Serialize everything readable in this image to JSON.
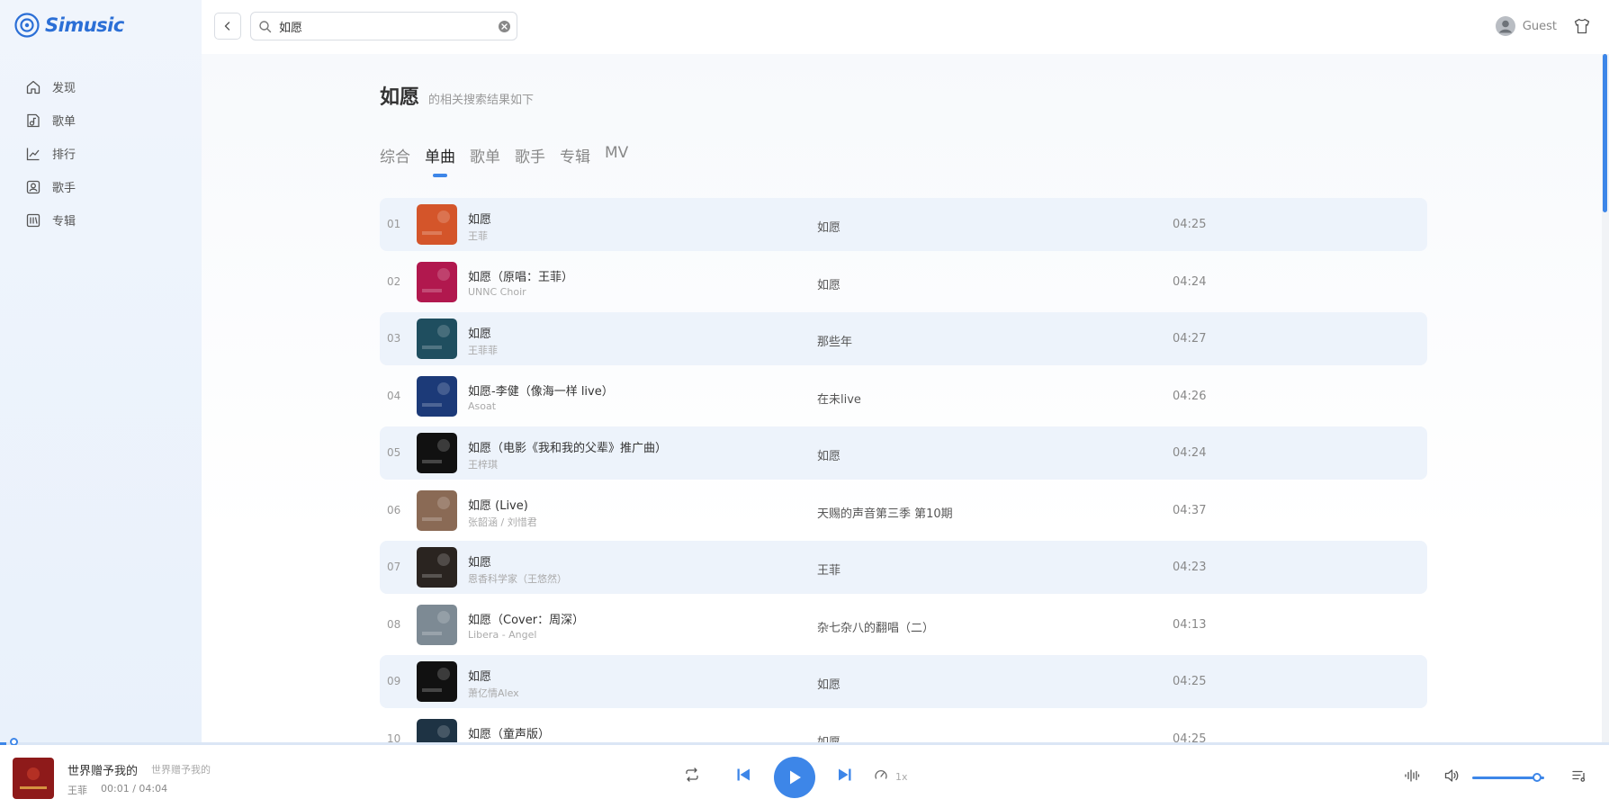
{
  "app": {
    "name": "Simusic"
  },
  "colors": {
    "accent": "#3d86e8",
    "stripe": "#edf3fb",
    "sidebar": "#eef4fb"
  },
  "sidebar": {
    "items": [
      {
        "label": "发现",
        "icon": "home-icon"
      },
      {
        "label": "歌单",
        "icon": "playlist-icon"
      },
      {
        "label": "排行",
        "icon": "chart-icon"
      },
      {
        "label": "歌手",
        "icon": "singer-icon"
      },
      {
        "label": "专辑",
        "icon": "album-icon"
      }
    ]
  },
  "header": {
    "search_value": "如愿",
    "user_name": "Guest"
  },
  "search": {
    "query": "如愿",
    "subtitle": "的相关搜索结果如下",
    "tabs": [
      "综合",
      "单曲",
      "歌单",
      "歌手",
      "专辑",
      "MV"
    ],
    "active_tab": "单曲"
  },
  "songs": [
    {
      "no": "01",
      "title": "如愿",
      "artist": "王菲",
      "album": "如愿",
      "duration": "04:25",
      "cover_color": "#d4552a"
    },
    {
      "no": "02",
      "title": "如愿（原唱：王菲）",
      "artist": "UNNC Choir",
      "album": "如愿",
      "duration": "04:24",
      "cover_color": "#b1184e"
    },
    {
      "no": "03",
      "title": "如愿",
      "artist": "王菲菲",
      "album": "那些年",
      "duration": "04:27",
      "cover_color": "#1f4e5f"
    },
    {
      "no": "04",
      "title": "如愿-李健（像海一样 live）",
      "artist": "Asoat",
      "album": "在未live",
      "duration": "04:26",
      "cover_color": "#1c3a78"
    },
    {
      "no": "05",
      "title": "如愿（电影《我和我的父辈》推广曲）",
      "artist": "王梓琪",
      "album": "如愿",
      "duration": "04:24",
      "cover_color": "#111111"
    },
    {
      "no": "06",
      "title": "如愿 (Live)",
      "artist": "张韶涵 / 刘惜君",
      "album": "天赐的声音第三季 第10期",
      "duration": "04:37",
      "cover_color": "#8a6a55"
    },
    {
      "no": "07",
      "title": "如愿",
      "artist": "恩香科学家（王悠然）",
      "album": "王菲",
      "duration": "04:23",
      "cover_color": "#2a2420"
    },
    {
      "no": "08",
      "title": "如愿（Cover：周深）",
      "artist": "Libera - Angel",
      "album": "杂七杂八的翻唱（二）",
      "duration": "04:13",
      "cover_color": "#7d8a94"
    },
    {
      "no": "09",
      "title": "如愿",
      "artist": "萧亿情Alex",
      "album": "如愿",
      "duration": "04:25",
      "cover_color": "#111111"
    },
    {
      "no": "10",
      "title": "如愿（童声版）",
      "artist": "",
      "album": "如愿",
      "duration": "04:25",
      "cover_color": "#1e3344"
    }
  ],
  "player": {
    "title": "世界赠予我的",
    "subtitle": "世界赠予我的",
    "artist": "王菲",
    "time": "00:01 / 04:04",
    "progress": 0.004,
    "speed": "1x",
    "volume": 0.9,
    "cover_color": "#8e1a1a"
  }
}
